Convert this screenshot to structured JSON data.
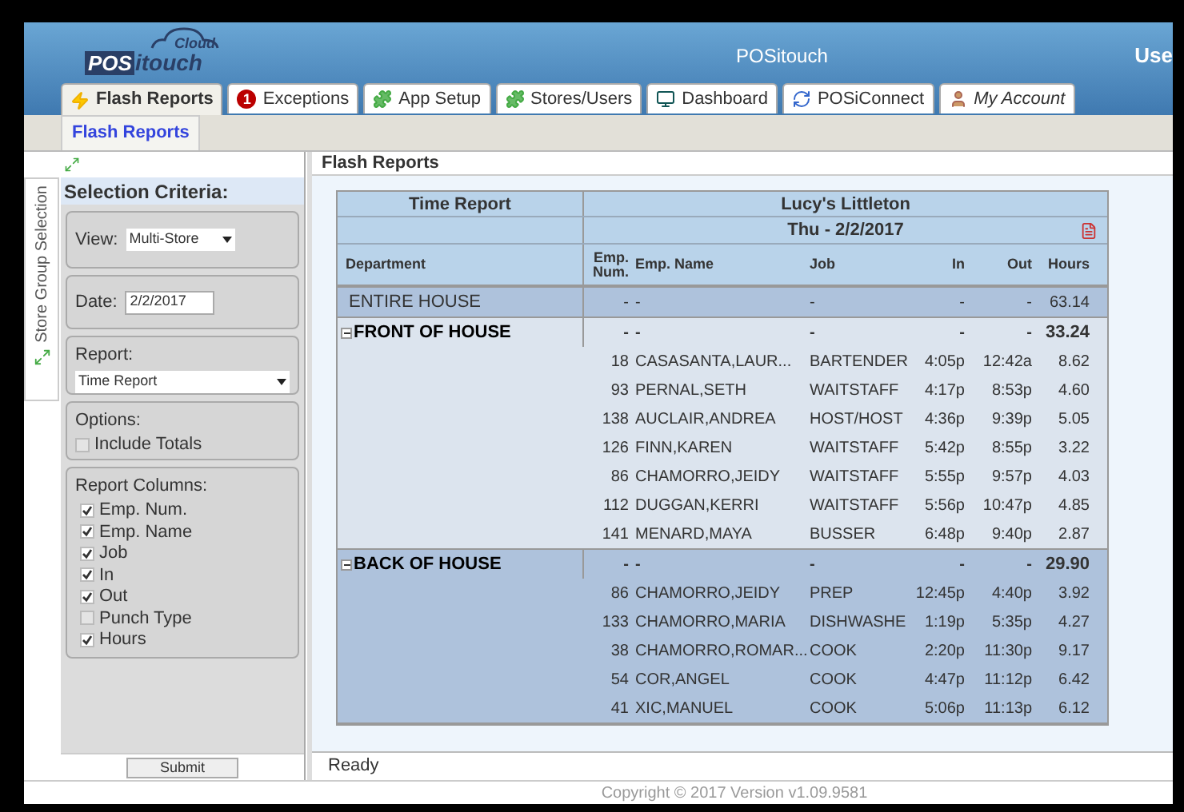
{
  "logo": {
    "cloud": "Cloud",
    "pos": "POS",
    "itouch": "itouch"
  },
  "header": {
    "title": "POSitouch",
    "user": "Use"
  },
  "tabs": [
    {
      "label": "Flash Reports",
      "selected": true
    },
    {
      "label": "Exceptions",
      "badge": "1",
      "selected": false
    },
    {
      "label": "App Setup",
      "selected": false
    },
    {
      "label": "Stores/Users",
      "selected": false
    },
    {
      "label": "Dashboard",
      "selected": false
    },
    {
      "label": "POSiConnect",
      "selected": false
    },
    {
      "label": "My Account",
      "selected": false
    }
  ],
  "sub_tabs": [
    {
      "label": "Flash Reports",
      "selected": true
    }
  ],
  "side_tab": "Store Group Selection",
  "sidebar": {
    "title": "Selection Criteria:",
    "view": {
      "label": "View:",
      "value": "Multi-Store"
    },
    "date": {
      "label": "Date:",
      "value": "2/2/2017"
    },
    "report": {
      "label": "Report:",
      "value": "Time Report"
    },
    "options": {
      "label": "Options:",
      "items": [
        {
          "label": "Include Totals",
          "checked": false
        }
      ]
    },
    "columns": {
      "label": "Report Columns:",
      "items": [
        {
          "label": "Emp. Num.",
          "checked": true
        },
        {
          "label": "Emp. Name",
          "checked": true
        },
        {
          "label": "Job",
          "checked": true
        },
        {
          "label": "In",
          "checked": true
        },
        {
          "label": "Out",
          "checked": true
        },
        {
          "label": "Punch Type",
          "checked": false
        },
        {
          "label": "Hours",
          "checked": true
        }
      ]
    },
    "submit": "Submit"
  },
  "content_title": "Flash Reports",
  "report": {
    "title": "Time Report",
    "store": "Lucy's Littleton",
    "date": "Thu - 2/2/2017",
    "columns": [
      "Department",
      "Emp. Num.",
      "Emp. Name",
      "Job",
      "In",
      "Out",
      "Hours"
    ],
    "groups": [
      {
        "name": "ENTIRE HOUSE",
        "kind": "total",
        "summary": [
          "-",
          "-",
          "-",
          "-",
          "-",
          "63.14"
        ]
      },
      {
        "name": "FRONT OF HOUSE",
        "kind": "group",
        "expanded": true,
        "summary": [
          "-",
          "-",
          "-",
          "-",
          "-",
          "33.24"
        ],
        "rows": [
          [
            "18",
            "CASASANTA,LAUR...",
            "BARTENDER",
            "4:05p",
            "12:42a",
            "8.62"
          ],
          [
            "93",
            "PERNAL,SETH",
            "WAITSTAFF",
            "4:17p",
            "8:53p",
            "4.60"
          ],
          [
            "138",
            "AUCLAIR,ANDREA",
            "HOST/HOST",
            "4:36p",
            "9:39p",
            "5.05"
          ],
          [
            "126",
            "FINN,KAREN",
            "WAITSTAFF",
            "5:42p",
            "8:55p",
            "3.22"
          ],
          [
            "86",
            "CHAMORRO,JEIDY",
            "WAITSTAFF",
            "5:55p",
            "9:57p",
            "4.03"
          ],
          [
            "112",
            "DUGGAN,KERRI",
            "WAITSTAFF",
            "5:56p",
            "10:47p",
            "4.85"
          ],
          [
            "141",
            "MENARD,MAYA",
            "BUSSER",
            "6:48p",
            "9:40p",
            "2.87"
          ]
        ]
      },
      {
        "name": "BACK OF HOUSE",
        "kind": "group",
        "expanded": true,
        "summary": [
          "-",
          "-",
          "-",
          "-",
          "-",
          "29.90"
        ],
        "rows": [
          [
            "86",
            "CHAMORRO,JEIDY",
            "PREP",
            "12:45p",
            "4:40p",
            "3.92"
          ],
          [
            "133",
            "CHAMORRO,MARIA",
            "DISHWASHE",
            "1:19p",
            "5:35p",
            "4.27"
          ],
          [
            "38",
            "CHAMORRO,ROMAR...",
            "COOK",
            "2:20p",
            "11:30p",
            "9.17"
          ],
          [
            "54",
            "COR,ANGEL",
            "COOK",
            "4:47p",
            "11:12p",
            "6.42"
          ],
          [
            "41",
            "XIC,MANUEL",
            "COOK",
            "5:06p",
            "11:13p",
            "6.12"
          ]
        ]
      }
    ]
  },
  "status": "Ready",
  "copyright": "Copyright © 2017 Version v1.09.9581"
}
